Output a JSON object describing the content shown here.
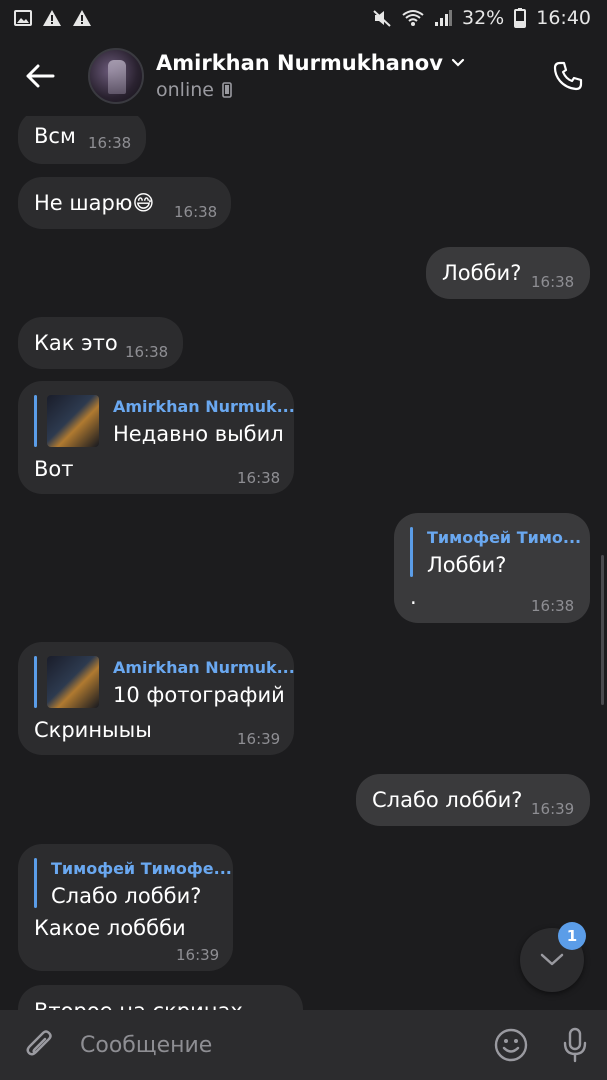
{
  "status_bar": {
    "battery": "32%",
    "time": "16:40"
  },
  "header": {
    "contact_name": "Amirkhan Nurmukhanov",
    "presence": "online"
  },
  "messages": [
    {
      "id": "m1",
      "direction": "in",
      "text": "Всм",
      "time": "16:38"
    },
    {
      "id": "m2",
      "direction": "in",
      "text": "Не шарю😅",
      "time": "16:38"
    },
    {
      "id": "m3",
      "direction": "out",
      "text": "Лобби?",
      "time": "16:38"
    },
    {
      "id": "m4",
      "direction": "in",
      "text": "Как это",
      "time": "16:38"
    },
    {
      "id": "m5",
      "direction": "in",
      "reply_to": {
        "name": "Amirkhan Nurmuk...",
        "text": "Недавно выбил"
      },
      "text": "Вот",
      "time": "16:38"
    },
    {
      "id": "m6",
      "direction": "out",
      "reply_to": {
        "name": "Тимофей Тимо...",
        "text": "Лобби?"
      },
      "text": ".",
      "time": "16:38"
    },
    {
      "id": "m7",
      "direction": "in",
      "reply_to": {
        "name": "Amirkhan Nurmuk...",
        "text": "10 фотографий"
      },
      "text": "Скриныыы",
      "time": "16:39"
    },
    {
      "id": "m8",
      "direction": "out",
      "text": "Слабо лобби?",
      "time": "16:39"
    },
    {
      "id": "m9",
      "direction": "in",
      "reply_to": {
        "name": "Тимофей Тимофе...",
        "text": "Слабо лобби?"
      },
      "text": "Какое лоббби",
      "time": "16:39"
    },
    {
      "id": "m10",
      "direction": "in",
      "text": "Второе на скринах",
      "time": ""
    }
  ],
  "scroll_down": {
    "unread_count": "1"
  },
  "composer": {
    "placeholder": "Сообщение"
  },
  "colors": {
    "background": "#1c1c1e",
    "bubble": "#2c2c2e",
    "accent": "#5b9de8"
  }
}
